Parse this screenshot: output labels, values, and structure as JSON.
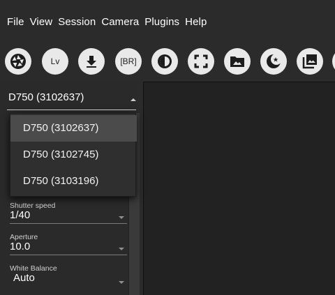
{
  "menu": {
    "file": "File",
    "view": "View",
    "session": "Session",
    "camera": "Camera",
    "plugins": "Plugins",
    "help": "Help"
  },
  "toolbar": {
    "buttons": [
      {
        "name": "shutter-release",
        "icon": "aperture-icon"
      },
      {
        "name": "live-view",
        "label": "Lv"
      },
      {
        "name": "download",
        "icon": "download-icon"
      },
      {
        "name": "bracketing",
        "label": "[BR]"
      },
      {
        "name": "timelapse",
        "icon": "timer-icon"
      },
      {
        "name": "focus",
        "icon": "focus-frame-icon"
      },
      {
        "name": "open-folder",
        "icon": "folder-image-icon"
      },
      {
        "name": "night-mode",
        "icon": "moon-star-icon"
      },
      {
        "name": "gallery",
        "icon": "gallery-icon"
      }
    ]
  },
  "camera_select": {
    "value": "D750 (3102637)",
    "options": [
      "D750 (3102637)",
      "D750 (3102745)",
      "D750 (3103196)"
    ]
  },
  "settings": {
    "shutter_speed": {
      "label": "Shutter speed",
      "value": "1/40"
    },
    "aperture": {
      "label": "Aperture",
      "value": "10.0"
    },
    "white_balance": {
      "label": "White Balance",
      "value": "Auto"
    }
  },
  "colors": {
    "background": "#2b2b2b",
    "button_fill": "#e9e9e9",
    "selected_option": "#4b4b4b"
  }
}
